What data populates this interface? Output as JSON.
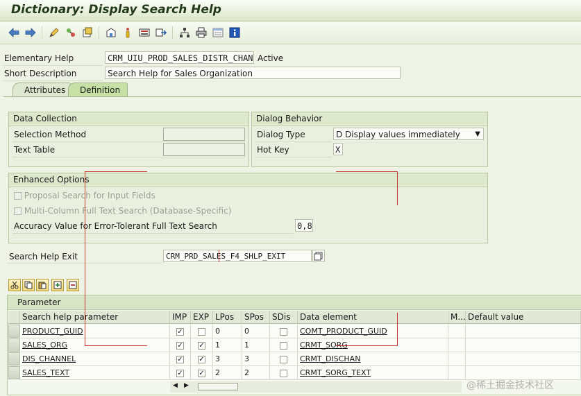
{
  "window": {
    "title": "Dictionary: Display Search Help"
  },
  "toolbar": {
    "icons": [
      "back-arrow-icon",
      "forward-arrow-icon",
      "display-change-icon",
      "other-object-icon",
      "activate-icon",
      "where-used-icon",
      "navigate-icon",
      "object-list-icon",
      "display-object-list-icon",
      "hierarchy-icon",
      "print-icon",
      "layout-icon",
      "info-icon"
    ]
  },
  "header": {
    "elementary_help_label": "Elementary Help",
    "elementary_help_value": "CRM_UIU_PROD_SALES_DISTR_CHAN",
    "status": "Active",
    "short_description_label": "Short Description",
    "short_description_value": "Search Help for Sales Organization"
  },
  "tabs": [
    {
      "label": "Attributes",
      "active": false
    },
    {
      "label": "Definition",
      "active": true
    }
  ],
  "data_collection": {
    "title": "Data Collection",
    "selection_method_label": "Selection Method",
    "selection_method_value": "",
    "text_table_label": "Text Table",
    "text_table_value": ""
  },
  "dialog_behavior": {
    "title": "Dialog Behavior",
    "dialog_type_label": "Dialog Type",
    "dialog_type_value": "D Display values immediately",
    "hot_key_label": "Hot Key",
    "hot_key_value": "X"
  },
  "enhanced_options": {
    "title": "Enhanced Options",
    "proposal_search_label": "Proposal Search for Input Fields",
    "multi_column_label": "Multi-Column Full Text Search (Database-Specific)",
    "accuracy_label": "Accuracy Value for Error-Tolerant Full Text Search",
    "accuracy_value": "0,8"
  },
  "search_help_exit": {
    "label": "Search Help Exit",
    "value": "CRM_PRD_SALES_F4_SHLP_EXIT"
  },
  "table_toolbar": {
    "icons": [
      "cut-icon",
      "copy-icon",
      "paste-icon",
      "insert-row-icon",
      "delete-row-icon"
    ]
  },
  "parameter_table": {
    "title": "Parameter",
    "columns": [
      "Search help parameter",
      "IMP",
      "EXP",
      "LPos",
      "SPos",
      "SDis",
      "Data element",
      "M...",
      "Default value"
    ],
    "rows": [
      {
        "param": "PRODUCT_GUID",
        "imp": true,
        "exp": false,
        "lpos": "0",
        "spos": "0",
        "sdis": false,
        "data_element": "COMT_PRODUCT_GUID",
        "m": "",
        "default": ""
      },
      {
        "param": "SALES_ORG",
        "imp": true,
        "exp": true,
        "lpos": "1",
        "spos": "1",
        "sdis": false,
        "data_element": "CRMT_SORG",
        "m": "",
        "default": ""
      },
      {
        "param": "DIS_CHANNEL",
        "imp": true,
        "exp": true,
        "lpos": "3",
        "spos": "3",
        "sdis": false,
        "data_element": "CRMT_DISCHAN",
        "m": "",
        "default": ""
      },
      {
        "param": "SALES_TEXT",
        "imp": true,
        "exp": true,
        "lpos": "2",
        "spos": "2",
        "sdis": false,
        "data_element": "CRMT_SORG_TEXT",
        "m": "",
        "default": ""
      }
    ]
  },
  "watermark": "@稀土掘金技术社区",
  "colors": {
    "annotation_red": "#c8372f",
    "tab_active": "#c7e0a5",
    "title_text": "#223a1a"
  }
}
